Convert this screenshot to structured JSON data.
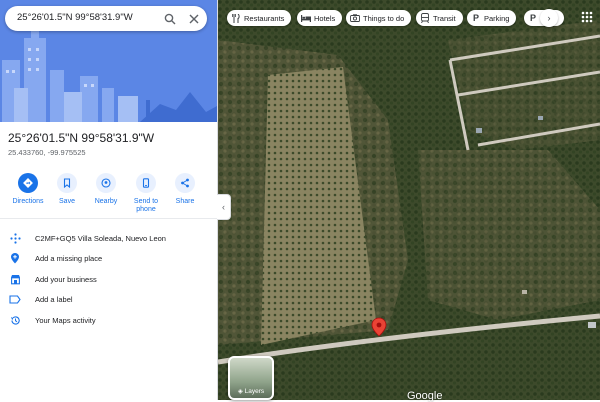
{
  "search": {
    "value": "25°26'01.5\"N 99°58'31.9\"W"
  },
  "place": {
    "title": "25°26'01.5\"N 99°58'31.9\"W",
    "decimal": "25.433760, -99.975525"
  },
  "actions": [
    {
      "label": "Directions",
      "icon": "directions-icon"
    },
    {
      "label": "Save",
      "icon": "bookmark-icon"
    },
    {
      "label": "Nearby",
      "icon": "nearby-icon"
    },
    {
      "label": "Send to\nphone",
      "icon": "phone-icon"
    },
    {
      "label": "Share",
      "icon": "share-icon"
    }
  ],
  "details": [
    {
      "text": "C2MF+GQ5 Villa Soleada, Nuevo Leon",
      "icon": "plus-code-icon"
    },
    {
      "text": "Add a missing place",
      "icon": "add-place-icon"
    },
    {
      "text": "Add your business",
      "icon": "business-icon"
    },
    {
      "text": "Add a label",
      "icon": "label-icon"
    },
    {
      "text": "Your Maps activity",
      "icon": "history-icon"
    }
  ],
  "chips": [
    {
      "label": "Restaurants",
      "icon": "fork-knife-icon"
    },
    {
      "label": "Hotels",
      "icon": "bed-icon"
    },
    {
      "label": "Things to do",
      "icon": "camera-icon"
    },
    {
      "label": "Transit",
      "icon": "transit-icon"
    },
    {
      "label": "Parking",
      "icon": "parking-icon"
    },
    {
      "label": "P",
      "icon": "pharmacy-icon"
    }
  ],
  "map": {
    "layers_label": "Layers",
    "logo": "Google",
    "view": "satellite"
  },
  "colors": {
    "accent": "#1a73e8",
    "action_circle": "#e8f0fe",
    "pin": "#ea4335",
    "hero": "#5b86e5"
  }
}
